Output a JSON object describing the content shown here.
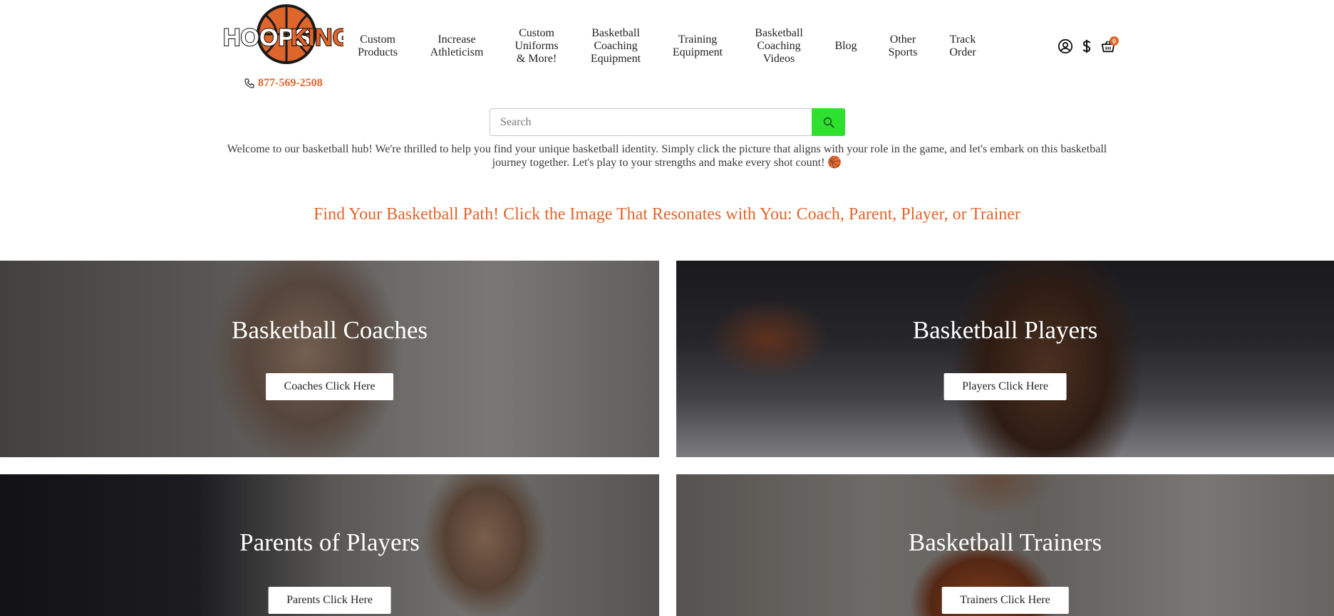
{
  "brand": {
    "logo_text_part1": "HOOPS",
    "logo_text_part2": "KING",
    "phone": "877-569-2508"
  },
  "nav": [
    {
      "line1": "Custom",
      "line2": "Products",
      "line3": ""
    },
    {
      "line1": "Increase",
      "line2": "Athleticism",
      "line3": ""
    },
    {
      "line1": "Custom",
      "line2": "Uniforms",
      "line3": "& More!"
    },
    {
      "line1": "Basketball",
      "line2": "Coaching",
      "line3": "Equipment"
    },
    {
      "line1": "Training",
      "line2": "Equipment",
      "line3": ""
    },
    {
      "line1": "Basketball",
      "line2": "Coaching",
      "line3": "Videos"
    },
    {
      "line1": "Blog",
      "line2": "",
      "line3": ""
    },
    {
      "line1": "Other",
      "line2": "Sports",
      "line3": ""
    },
    {
      "line1": "Track",
      "line2": "Order",
      "line3": ""
    }
  ],
  "header_icons": {
    "account": "user-circle-icon",
    "currency": "dollar-icon",
    "cart": "basket-icon",
    "cart_count": "0"
  },
  "search": {
    "placeholder": "Search",
    "value": ""
  },
  "welcome_text": "Welcome to our basketball hub! We're thrilled to help you find your unique basketball identity. Simply click the picture that aligns with your role in the game, and let's embark on this basketball journey together. Let's play to your strengths and make every shot count! 🏀",
  "path_heading": "Find Your Basketball Path! Click the Image That Resonates with You: Coach, Parent, Player, or Trainer",
  "cards": {
    "coaches": {
      "title": "Basketball Coaches",
      "button": "Coaches Click Here"
    },
    "players": {
      "title": "Basketball Players",
      "button": "Players Click Here"
    },
    "parents": {
      "title": "Parents of Players",
      "button": "Parents Click Here"
    },
    "trainers": {
      "title": "Basketball Trainers",
      "button": "Trainers Click Here"
    }
  },
  "colors": {
    "accent": "#e0652a",
    "search_button": "#2fe02f"
  }
}
